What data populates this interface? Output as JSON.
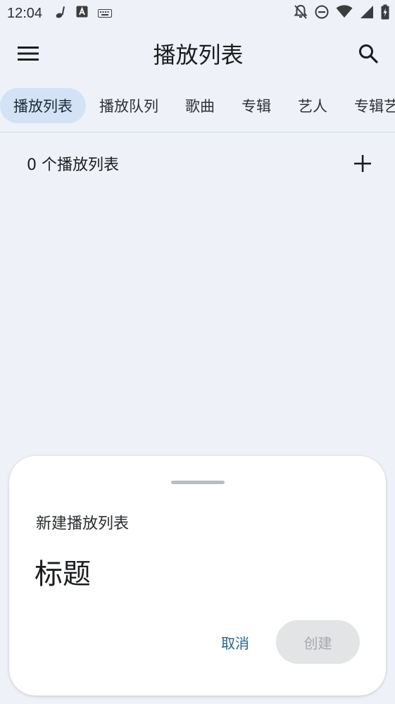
{
  "status_bar": {
    "time": "12:04"
  },
  "app_bar": {
    "title": "播放列表"
  },
  "tabs": [
    {
      "label": "播放列表",
      "active": true
    },
    {
      "label": "播放队列",
      "active": false
    },
    {
      "label": "歌曲",
      "active": false
    },
    {
      "label": "专辑",
      "active": false
    },
    {
      "label": "艺人",
      "active": false
    },
    {
      "label": "专辑艺",
      "active": false
    }
  ],
  "list_header": {
    "count_text": "0 个播放列表"
  },
  "dialog": {
    "title": "新建播放列表",
    "input_placeholder": "标题",
    "input_value": "",
    "cancel_label": "取消",
    "create_label": "创建"
  },
  "colors": {
    "background": "#eef2f8",
    "tab_active_bg": "#d3e3f5",
    "cancel_text": "#2a6485",
    "create_disabled_bg": "#e3e4e6",
    "create_disabled_text": "#a5a8ad"
  }
}
